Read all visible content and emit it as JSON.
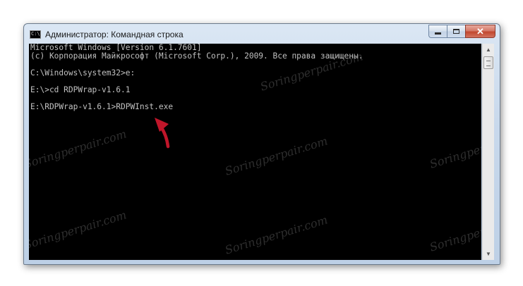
{
  "window": {
    "title": "Администратор: Командная строка",
    "icon_label": "C:\\",
    "controls": {
      "minimize": "minimize-icon",
      "maximize": "maximize-icon",
      "close": "close-icon"
    }
  },
  "console": {
    "lines": [
      "Microsoft Windows [Version 6.1.7601]",
      "(c) Корпорация Майкрософт (Microsoft Corp.), 2009. Все права защищены.",
      "",
      "C:\\Windows\\system32>e:",
      "",
      "E:\\>cd RDPWrap-v1.6.1",
      "",
      "E:\\RDPWrap-v1.6.1>RDPWInst.exe"
    ],
    "text_color": "#c0c0c0",
    "background": "#000000"
  },
  "watermark": {
    "text": "Soringperpair.com"
  },
  "annotation": {
    "arrow_color": "#c0172b",
    "arrow_icon": "pointer-arrow-icon"
  },
  "scrollbar": {
    "up_icon": "scroll-up-icon",
    "down_icon": "scroll-down-icon"
  }
}
